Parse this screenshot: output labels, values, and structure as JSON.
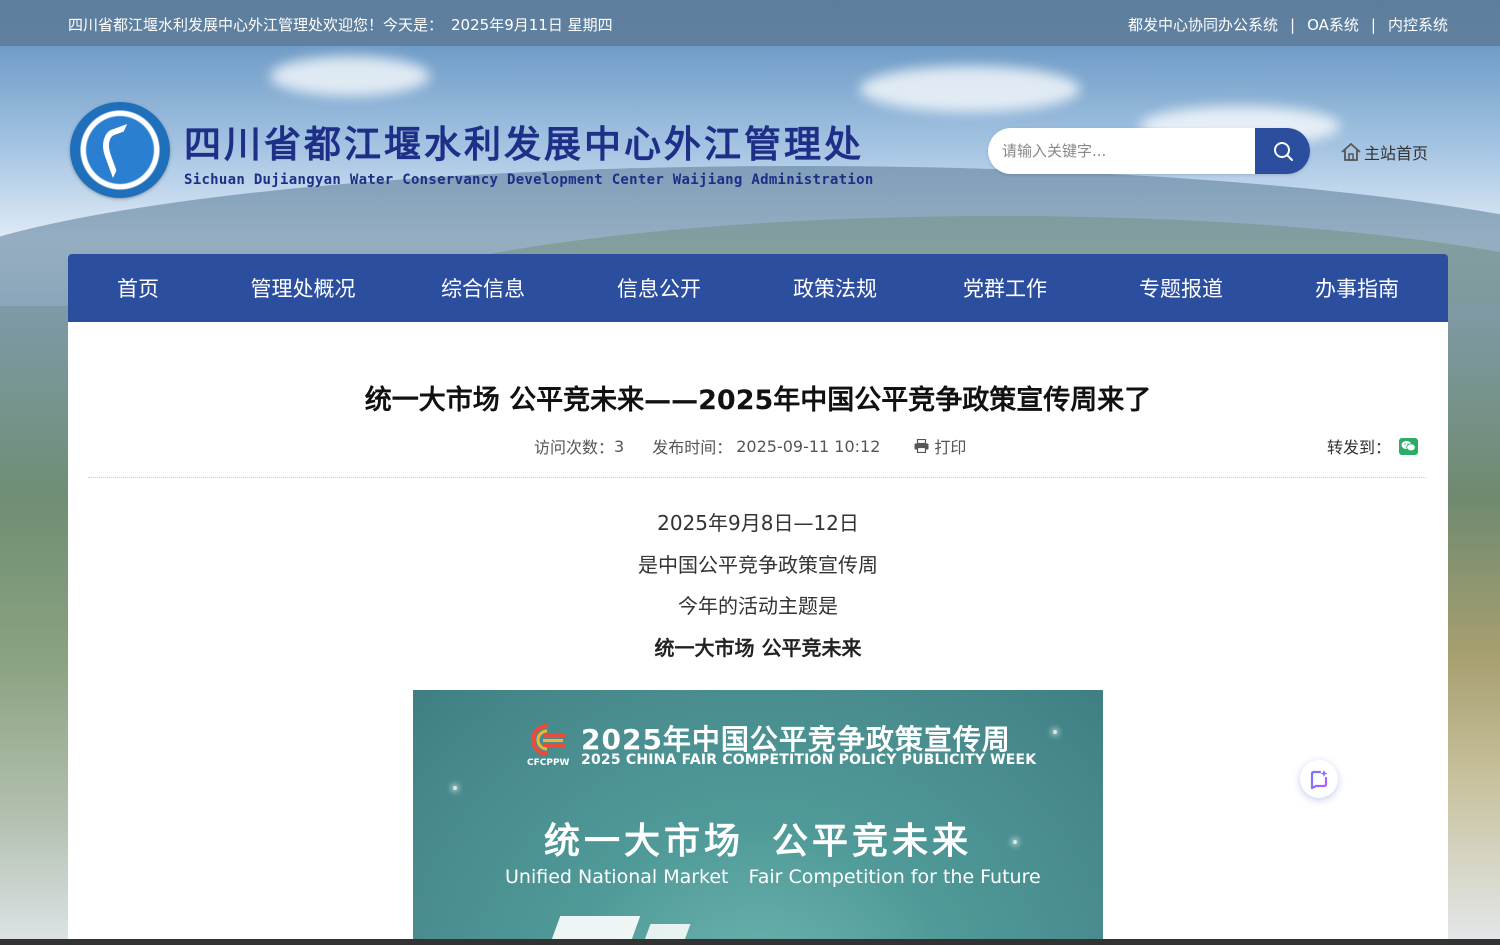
{
  "topbar": {
    "welcome": "四川省都江堰水利发展中心外江管理处欢迎您！今天是：",
    "date": "2025年9月11日 星期四",
    "links": [
      {
        "label": "都发中心协同办公系统"
      },
      {
        "label": "OA系统"
      },
      {
        "label": "内控系统"
      }
    ],
    "separator": "|"
  },
  "header": {
    "title_cn": "四川省都江堰水利发展中心外江管理处",
    "title_en": "Sichuan Dujiangyan Water Conservancy Development Center Waijiang Administration",
    "search_placeholder": "请输入关键字...",
    "home_label": "主站首页"
  },
  "nav": {
    "items": [
      {
        "label": "首页"
      },
      {
        "label": "管理处概况"
      },
      {
        "label": "综合信息"
      },
      {
        "label": "信息公开"
      },
      {
        "label": "政策法规"
      },
      {
        "label": "党群工作"
      },
      {
        "label": "专题报道"
      },
      {
        "label": "办事指南"
      }
    ]
  },
  "article": {
    "title": "统一大市场 公平竞未来——2025年中国公平竞争政策宣传周来了",
    "visits_label": "访问次数：",
    "visits": "3",
    "publish_label": "发布时间：",
    "publish_time": "2025-09-11 10:12",
    "print_label": "打印",
    "share_label": "转发到：",
    "lines": [
      "2025年9月8日—12日",
      "是中国公平竞争政策宣传周",
      "今年的活动主题是",
      "统一大市场 公平竞未来"
    ]
  },
  "poster": {
    "logo_text": "CFCPPW",
    "title_cn": "2025年中国公平竞争政策宣传周",
    "title_en": "2025 CHINA FAIR COMPETITION POLICY PUBLICITY WEEK",
    "slogan_left": "统一大市场",
    "slogan_right": "公平竞未来",
    "en_left": "Unified National Market",
    "en_right": "Fair Competition for the Future"
  },
  "colors": {
    "nav_bg": "#2c4e9f",
    "title_blue": "#1d2f86",
    "wechat_green": "#2aae67"
  },
  "icons": {
    "search": "magnifier-icon",
    "home": "house-icon",
    "print": "printer-icon",
    "share": "wechat-icon",
    "float": "ai-assistant-icon"
  }
}
